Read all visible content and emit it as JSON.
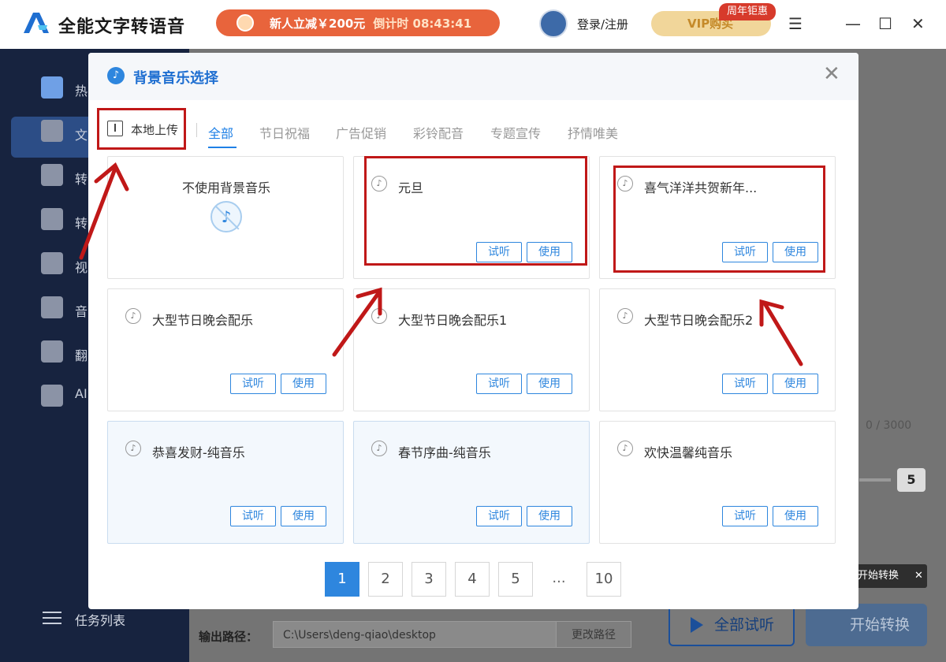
{
  "app": {
    "name": "全能文字转语音",
    "promo_text": "新人立减￥200元",
    "promo_timer": "倒计时 08:43:41",
    "login": "登录/注册",
    "vip": "VIP购买",
    "vip_badge": "周年钜惠"
  },
  "sidebar": {
    "items": [
      {
        "label": "热"
      },
      {
        "label": "文"
      },
      {
        "label": "转"
      },
      {
        "label": "转"
      },
      {
        "label": "视"
      },
      {
        "label": "音"
      },
      {
        "label": "翻"
      },
      {
        "label": "AI"
      }
    ],
    "task_list": "任务列表"
  },
  "main": {
    "counter": "0 / 3000",
    "speed": "5",
    "tooltip": "开始转换",
    "output_label": "输出路径：",
    "output_path": "C:\\Users\\deng-qiao\\desktop",
    "change_path": "更改路径",
    "all_preview": "全部试听",
    "start_convert": "开始转换"
  },
  "modal": {
    "title": "背景音乐选择",
    "upload": "本地上传",
    "tabs": [
      {
        "label": "全部",
        "active": true
      },
      {
        "label": "节日祝福"
      },
      {
        "label": "广告促销"
      },
      {
        "label": "彩铃配音"
      },
      {
        "label": "专题宣传"
      },
      {
        "label": "抒情唯美"
      }
    ],
    "no_music": "不使用背景音乐",
    "cards": [
      {
        "title": "元旦"
      },
      {
        "title": "喜气洋洋共贺新年..."
      },
      {
        "title": "大型节日晚会配乐"
      },
      {
        "title": "大型节日晚会配乐1"
      },
      {
        "title": "大型节日晚会配乐2"
      },
      {
        "title": "恭喜发财-纯音乐"
      },
      {
        "title": "春节序曲-纯音乐"
      },
      {
        "title": "欢快温馨纯音乐"
      }
    ],
    "preview_label": "试听",
    "use_label": "使用",
    "pages": [
      "1",
      "2",
      "3",
      "4",
      "5",
      "...",
      "10"
    ],
    "current_page": "1"
  },
  "colors": {
    "accent": "#2e86de",
    "annotation": "#c01818"
  }
}
